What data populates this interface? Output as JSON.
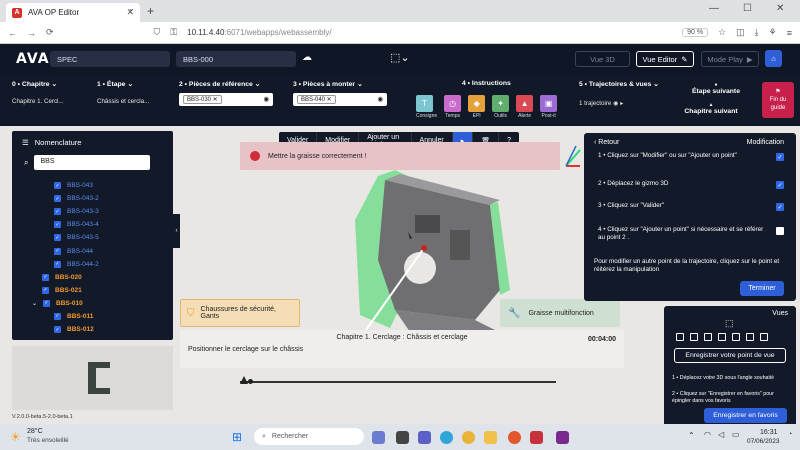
{
  "browser": {
    "tab_title": "AVA OP Editor",
    "url_host": "10.11.4.40",
    "url_rest": ":6071/webapps/webassembly/",
    "zoom": "90 %"
  },
  "header": {
    "brand": "AVA",
    "project": "SPEC",
    "assembly": "BBS-000",
    "view3d": "Vue 3D",
    "view_editor": "Vue Editor",
    "mode_play": "Mode Play"
  },
  "config": {
    "chapitre_h": "0 • Chapitre",
    "chapitre_v": "Chapitre 1. Cercl...",
    "etape_h": "1 • Étape",
    "etape_v": "Châssis et cercla...",
    "pieces_ref_h": "2 • Pièces de référence",
    "pieces_ref_chip": "BBS-030",
    "pieces_mon_h": "3 • Pièces à monter",
    "pieces_mon_chip": "BBS-040",
    "instructions_h": "4 • Instructions",
    "instructions": [
      {
        "label": "Consigne",
        "glyph": "T",
        "color": "#7cc7cf"
      },
      {
        "label": "Temps",
        "glyph": "◷",
        "color": "#c86bcb"
      },
      {
        "label": "EPI",
        "glyph": "◆",
        "color": "#e5a23c"
      },
      {
        "label": "Outils",
        "glyph": "✦",
        "color": "#5fae6e"
      },
      {
        "label": "Alerte",
        "glyph": "▲",
        "color": "#d94a55"
      },
      {
        "label": "Post-it",
        "glyph": "▣",
        "color": "#9c6bd3"
      }
    ],
    "traj_h": "5 • Trajectoires & vues",
    "traj_v": "1 trajectoire",
    "etape_suivante": "Étape suivante",
    "chapitre_suivant": "Chapitre suivant",
    "fin_guide_1": "Fin du",
    "fin_guide_2": "guide"
  },
  "nomenclature": {
    "title": "Nomenclature",
    "search_value": "BBS",
    "items": [
      {
        "label": "BBS-043",
        "level": 2,
        "color": "blue"
      },
      {
        "label": "BBS-043-2",
        "level": 2,
        "color": "blue"
      },
      {
        "label": "BBS-043-3",
        "level": 2,
        "color": "blue"
      },
      {
        "label": "BBS-043-4",
        "level": 2,
        "color": "blue"
      },
      {
        "label": "BBS-043-5",
        "level": 2,
        "color": "blue"
      },
      {
        "label": "BBS-044",
        "level": 2,
        "color": "blue"
      },
      {
        "label": "BBS-044-2",
        "level": 2,
        "color": "blue"
      },
      {
        "label": "BBS-020",
        "level": 1,
        "color": "orange"
      },
      {
        "label": "BBS-021",
        "level": 1,
        "color": "orange"
      },
      {
        "label": "BBS-010",
        "level": 1,
        "color": "orange",
        "expanded": true
      },
      {
        "label": "BBS-011",
        "level": 2,
        "color": "orange"
      },
      {
        "label": "BBS-012",
        "level": 2,
        "color": "orange"
      }
    ],
    "version": "V.2.0.0-beta.5-2.0-beta.1"
  },
  "toolbar": {
    "valider": "Valider",
    "modifier": "Modifier",
    "ajouter": "Ajouter un point",
    "annuler": "Annuler"
  },
  "viewport": {
    "alert_text": "Mettre la graisse correctement !",
    "epi_text": "Chaussures de sécurité, Gants",
    "tool_text": "Graisse multifonction",
    "step_title": "Chapitre 1. Cerclage : Châssis et cerclage",
    "step_time": "00:04:00",
    "step_desc": "Positionner le cerclage sur le châssis"
  },
  "trajectory_panel": {
    "back": "Retour",
    "mode": "Modification",
    "steps": [
      {
        "text": "1 • Cliquez sur \"Modifier\" ou sur \"Ajouter un point\"",
        "checked": true
      },
      {
        "text": "2 • Déplacez le gizmo 3D",
        "checked": true
      },
      {
        "text": "3 • Cliquez sur \"Valider\"",
        "checked": true
      },
      {
        "text": "4 • Cliquez sur \"Ajouter un point\" si nécessaire et se référer au point 2 .",
        "checked": false
      }
    ],
    "hint": "Pour modifier un autre point de la trajectoire, cliquez sur le point et réitérez la manipulation",
    "finish": "Terminer"
  },
  "views_panel": {
    "title": "Vues",
    "save_view": "Enregistrer votre point de vue",
    "tip1": "1 • Déplacez votre 3D sous l'angle souhaité",
    "tip2": "2 • Cliquez sur \"Enregistrer en favoris\" pour épingler dans vos favoris",
    "save_fav": "Enregistrer en favoris"
  },
  "taskbar": {
    "temp": "28°C",
    "weather": "Très ensoleillé",
    "search_placeholder": "Rechercher",
    "time": "16:31",
    "date": "07/06/2023"
  }
}
